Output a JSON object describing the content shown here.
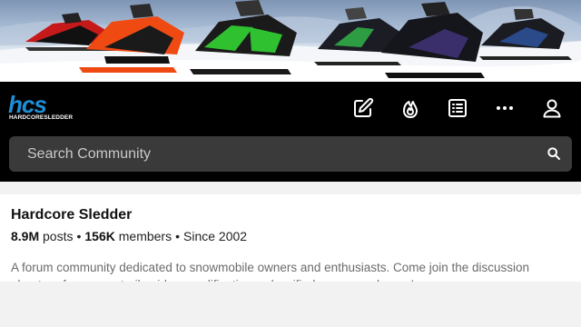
{
  "banner": {
    "alt": "snowmobiles banner"
  },
  "brand": {
    "logo_main": "hcs",
    "logo_sub": "HARDCORESLEDDER",
    "accent": "#1e8ed6"
  },
  "header": {
    "icons": [
      "edit-icon",
      "fire-icon",
      "list-icon",
      "more-icon",
      "user-icon"
    ]
  },
  "search": {
    "placeholder": "Search Community"
  },
  "community": {
    "name": "Hardcore Sledder",
    "posts_count": "8.9M",
    "posts_label": "posts",
    "members_count": "156K",
    "members_label": "members",
    "since": "Since 2002",
    "separator": "•",
    "description": "A forum community dedicated to snowmobile owners and enthusiasts. Come join the discussion about performance, trail guides, modifications, classifieds, gear, and more!"
  }
}
